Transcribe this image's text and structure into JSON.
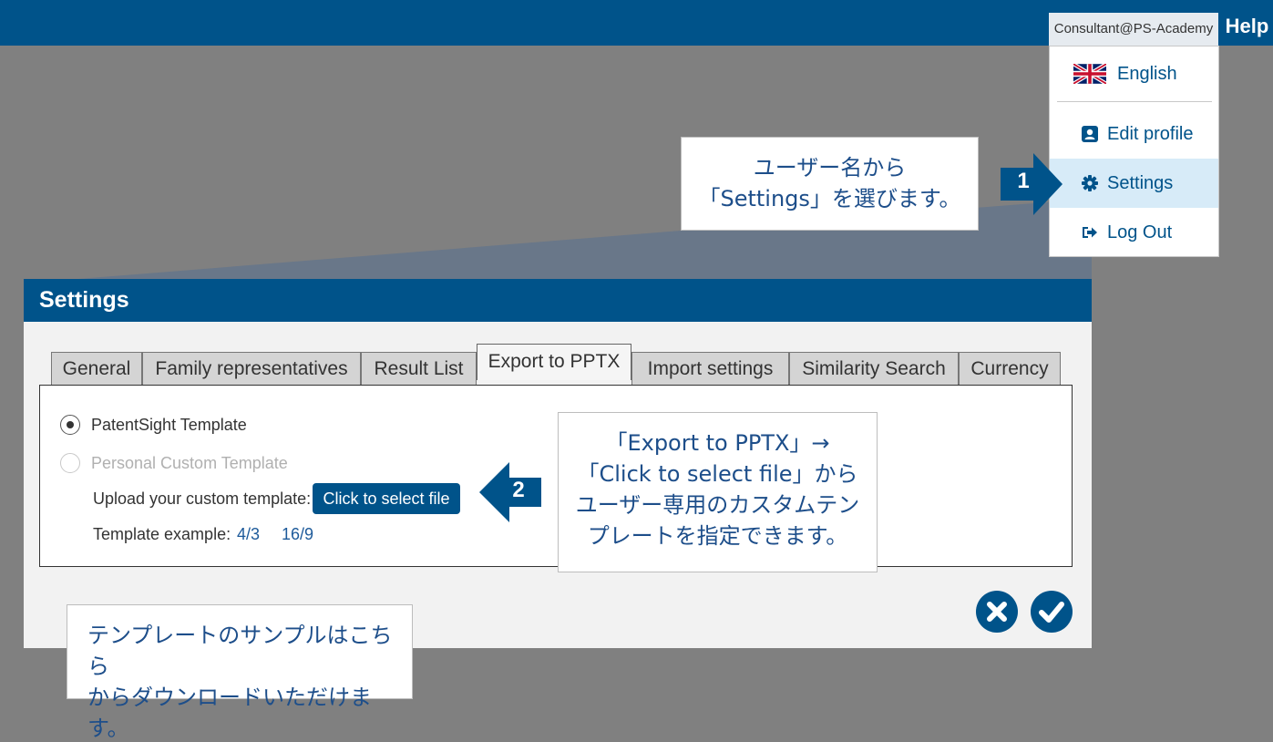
{
  "header": {
    "user": "Consultant@PS-Academy",
    "help": "Help"
  },
  "user_menu": {
    "language": "English",
    "edit_profile": "Edit profile",
    "settings": "Settings",
    "log_out": "Log Out"
  },
  "callouts": {
    "step1_badge": "1",
    "step1_line1": "ユーザー名から",
    "step1_line2": "「Settings」を選びます。",
    "step2_badge": "2",
    "step2_line1": "「Export to PPTX」→",
    "step2_line2": "「Click to select file」から",
    "step2_line3": "ユーザー専用のカスタムテン",
    "step2_line4": "プレートを指定できます。",
    "step3_line1": "テンプレートのサンプルはこちら",
    "step3_line2": "からダウンロードいただけます。"
  },
  "dialog": {
    "title": "Settings",
    "tabs": [
      {
        "label": "General"
      },
      {
        "label": "Family representatives"
      },
      {
        "label": "Result List"
      },
      {
        "label": "Export to PPTX"
      },
      {
        "label": "Import settings"
      },
      {
        "label": "Similarity Search"
      },
      {
        "label": "Currency"
      }
    ],
    "active_tab": "Export to PPTX",
    "options": [
      {
        "label": "PatentSight Template",
        "selected": true,
        "enabled": true
      },
      {
        "label": "Personal Custom Template",
        "selected": false,
        "enabled": false
      }
    ],
    "upload_label": "Upload your custom template:",
    "select_file_button": "Click to select file",
    "example_label": "Template example:",
    "example_links": [
      "4/3",
      "16/9"
    ]
  },
  "colors": {
    "brand": "#00538a",
    "highlight": "#d7ebf8",
    "callout_text": "#1d4e8a",
    "overlay": "#808080"
  }
}
